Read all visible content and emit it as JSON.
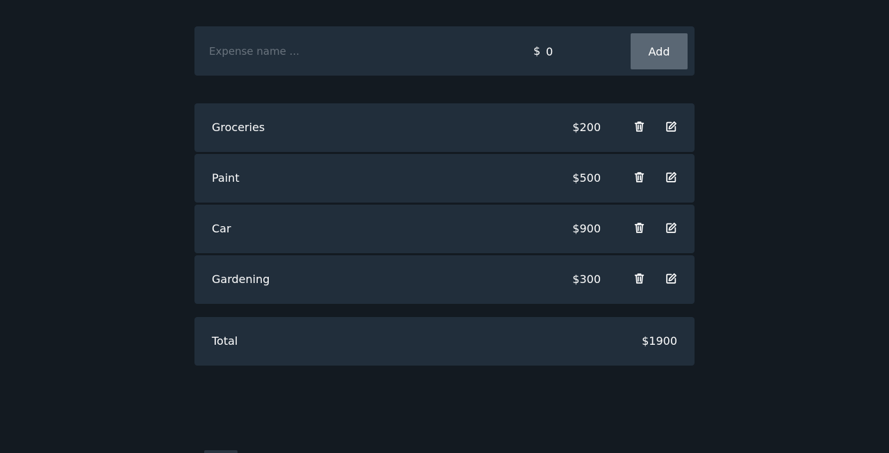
{
  "form": {
    "name_placeholder": "Expense name ...",
    "name_value": "",
    "currency_symbol": "$",
    "amount_value": "0",
    "add_label": "Add"
  },
  "expenses": [
    {
      "name": "Groceries",
      "amount": "$200"
    },
    {
      "name": "Paint",
      "amount": "$500"
    },
    {
      "name": "Car",
      "amount": "$900"
    },
    {
      "name": "Gardening",
      "amount": "$300"
    }
  ],
  "total": {
    "label": "Total",
    "value": "$1900"
  },
  "icons": {
    "delete": "trash-icon",
    "edit": "edit-icon"
  },
  "colors": {
    "background": "#131a21",
    "card": "#212e3b",
    "button": "#5a6774",
    "placeholder": "#69737d",
    "text": "#ffffff"
  }
}
